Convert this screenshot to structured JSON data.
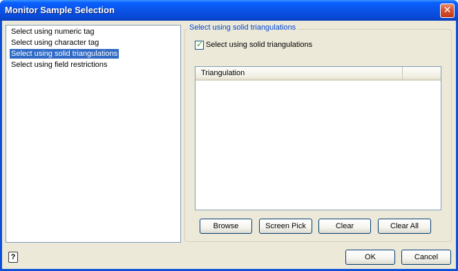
{
  "window": {
    "title": "Monitor Sample Selection",
    "close_icon": "close-icon",
    "accent_color": "#0a53e6"
  },
  "left_panel": {
    "items": [
      {
        "label": "Select using numeric tag",
        "selected": false
      },
      {
        "label": "Select using character tag",
        "selected": false
      },
      {
        "label": "Select using solid triangulations",
        "selected": true
      },
      {
        "label": "Select using field restrictions",
        "selected": false
      }
    ]
  },
  "group": {
    "legend": "Select using solid triangulations",
    "checkbox": {
      "label": "Select using solid triangulations",
      "checked": true
    },
    "table": {
      "columns": [
        "Triangulation"
      ],
      "rows": []
    },
    "buttons": {
      "browse": "Browse",
      "screen_pick": "Screen Pick",
      "clear": "Clear",
      "clear_all": "Clear All"
    }
  },
  "footer": {
    "help_icon": "help-icon",
    "ok": "OK",
    "cancel": "Cancel"
  }
}
